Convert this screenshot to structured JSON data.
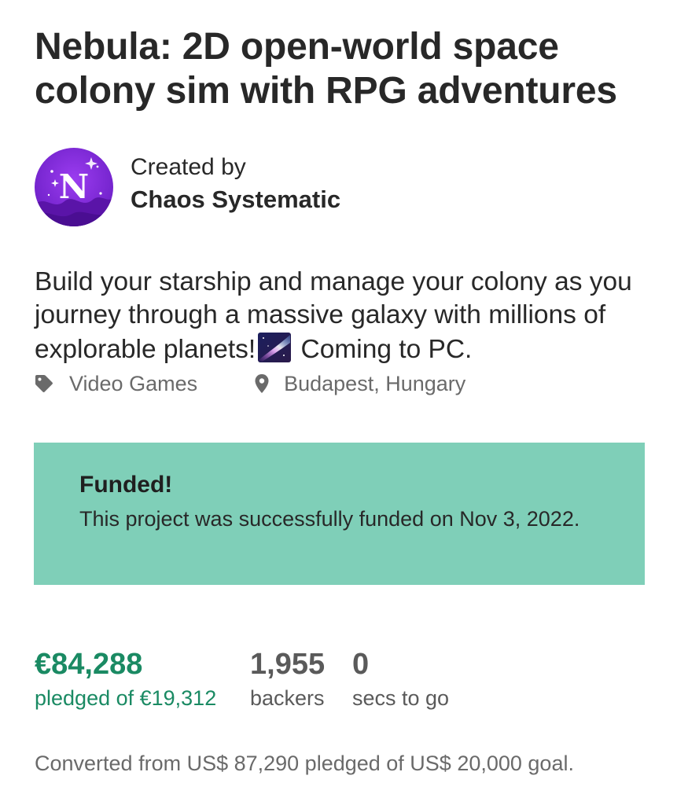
{
  "project": {
    "title": "Nebula: 2D open-world space colony sim with RPG adventures",
    "creator_label": "Created by",
    "creator_name": "Chaos Systematic",
    "avatar_letter": "N",
    "blurb_before_emoji": "Build your starship and manage your colony as you journey through a massive galaxy with millions of explorable planets!",
    "blurb_emoji_icon": "milky-way-emoji",
    "blurb_after_emoji": " Coming to PC.",
    "category": "Video Games",
    "category_icon": "tag-icon",
    "location": "Budapest, Hungary",
    "location_icon": "location-pin-icon"
  },
  "funding_status": {
    "title": "Funded!",
    "message": "This project was successfully funded on Nov 3, 2022.",
    "background_color": "#7fcfb8"
  },
  "stats": {
    "pledged_value": "€84,288",
    "pledged_label": "pledged of €19,312",
    "backers_value": "1,955",
    "backers_label": "backers",
    "time_value": "0",
    "time_label": "secs to go",
    "accent_color": "#1a8a63"
  },
  "conversion_note": "Converted from US$ 87,290 pledged of US$ 20,000 goal."
}
